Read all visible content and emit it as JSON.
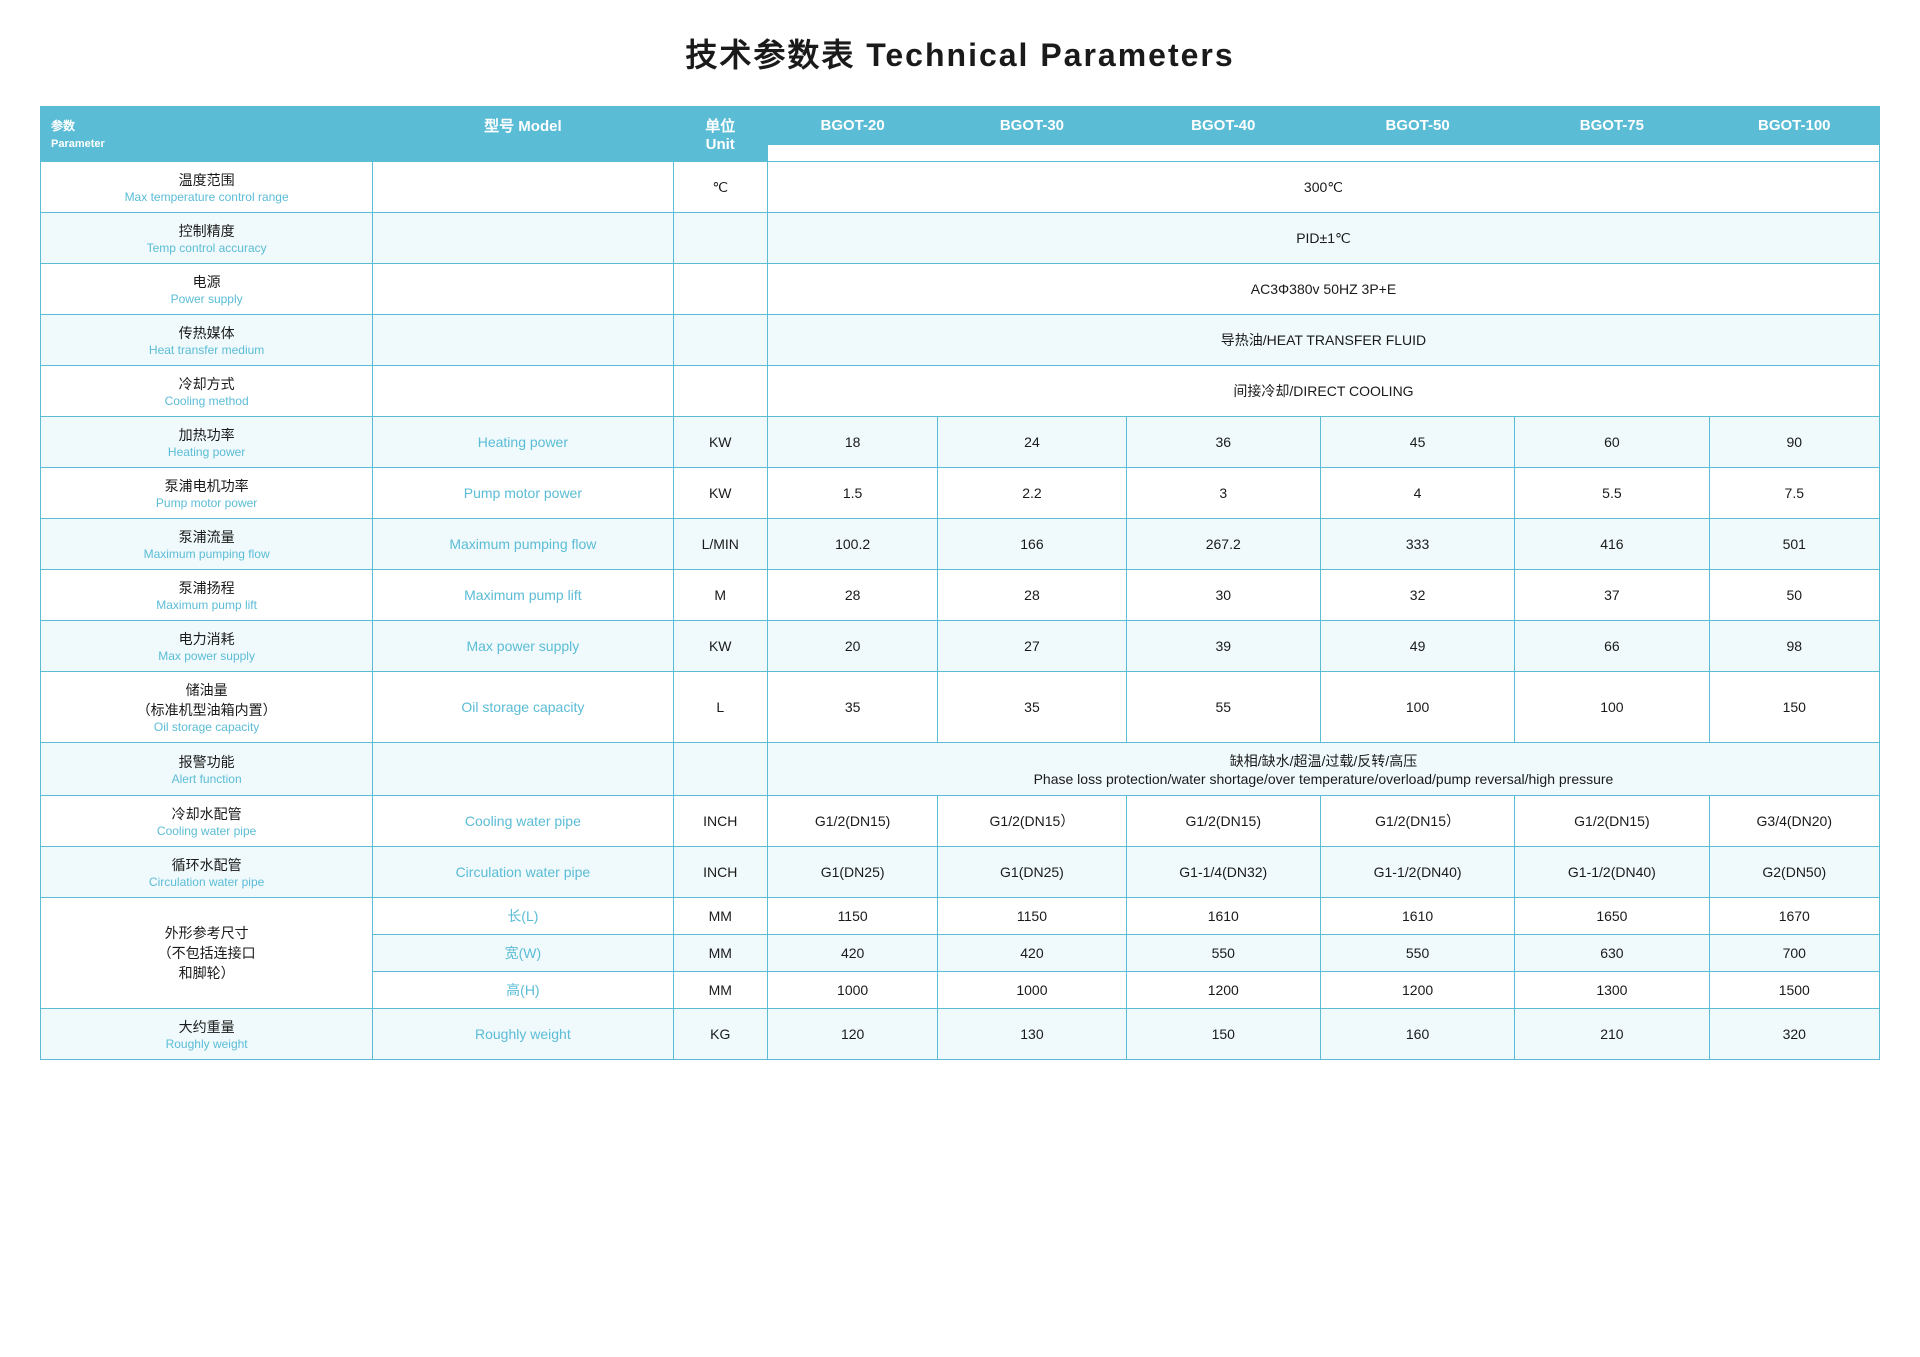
{
  "title": "技术参数表 Technical Parameters",
  "table": {
    "header": {
      "param_zh": "参数",
      "param_en": "Parameter",
      "model_zh": "型号",
      "model_en": "Model",
      "unit_zh": "单位",
      "unit_en": "Unit",
      "models": [
        "BGOT-20",
        "BGOT-30",
        "BGOT-40",
        "BGOT-50",
        "BGOT-75",
        "BGOT-100"
      ]
    },
    "rows": [
      {
        "param_zh": "温度范围",
        "param_en": "Max temperature control range",
        "unit": "℃",
        "span": true,
        "span_value": "300℃"
      },
      {
        "param_zh": "控制精度",
        "param_en": "Temp control accuracy",
        "unit": "",
        "span": true,
        "span_value": "PID±1℃"
      },
      {
        "param_zh": "电源",
        "param_en": "Power supply",
        "unit": "",
        "span": true,
        "span_value": "AC3Φ380v 50HZ 3P+E"
      },
      {
        "param_zh": "传热媒体",
        "param_en": "Heat transfer medium",
        "unit": "",
        "span": true,
        "span_value": "导热油/HEAT TRANSFER FLUID"
      },
      {
        "param_zh": "冷却方式",
        "param_en": "Cooling method",
        "unit": "",
        "span": true,
        "span_value": "间接冷却/DIRECT COOLING"
      },
      {
        "param_zh": "加热功率",
        "param_en": "Heating power",
        "unit": "KW",
        "span": false,
        "values": [
          "18",
          "24",
          "36",
          "45",
          "60",
          "90"
        ]
      },
      {
        "param_zh": "泵浦电机功率",
        "param_en": "Pump motor power",
        "unit": "KW",
        "span": false,
        "values": [
          "1.5",
          "2.2",
          "3",
          "4",
          "5.5",
          "7.5"
        ]
      },
      {
        "param_zh": "泵浦流量",
        "param_en": "Maximum pumping flow",
        "unit": "L/MIN",
        "span": false,
        "values": [
          "100.2",
          "166",
          "267.2",
          "333",
          "416",
          "501"
        ]
      },
      {
        "param_zh": "泵浦扬程",
        "param_en": "Maximum pump lift",
        "unit": "M",
        "span": false,
        "values": [
          "28",
          "28",
          "30",
          "32",
          "37",
          "50"
        ]
      },
      {
        "param_zh": "电力消耗",
        "param_en": "Max power supply",
        "unit": "KW",
        "span": false,
        "values": [
          "20",
          "27",
          "39",
          "49",
          "66",
          "98"
        ]
      },
      {
        "param_zh": "储油量\n（标准机型油箱内置）",
        "param_en": "Oil storage capacity",
        "unit": "L",
        "span": false,
        "values": [
          "35",
          "35",
          "55",
          "100",
          "100",
          "150"
        ]
      },
      {
        "param_zh": "报警功能",
        "param_en": "Alert function",
        "unit": "",
        "span": true,
        "span_value": "缺相/缺水/超温/过载/反转/高压\nPhase loss protection/water shortage/over temperature/overload/pump reversal/high pressure"
      },
      {
        "param_zh": "冷却水配管",
        "param_en": "Cooling water pipe",
        "unit": "INCH",
        "span": false,
        "values": [
          "G1/2(DN15)",
          "G1/2(DN15）",
          "G1/2(DN15)",
          "G1/2(DN15）",
          "G1/2(DN15)",
          "G3/4(DN20)"
        ]
      },
      {
        "param_zh": "循环水配管",
        "param_en": "Circulation water pipe",
        "unit": "INCH",
        "span": false,
        "values": [
          "G1(DN25)",
          "G1(DN25)",
          "G1-1/4(DN32)",
          "G1-1/2(DN40)",
          "G1-1/2(DN40)",
          "G2(DN50)"
        ]
      },
      {
        "param_zh": "外形参考尺寸\n（不包括连接口\n和脚轮）",
        "param_en": "长(L)",
        "unit": "MM",
        "span": false,
        "values": [
          "1150",
          "1150",
          "1610",
          "1610",
          "1650",
          "1670"
        ],
        "rowspan_label": true
      },
      {
        "param_zh": "",
        "param_en": "宽(W)",
        "unit": "MM",
        "span": false,
        "values": [
          "420",
          "420",
          "550",
          "550",
          "630",
          "700"
        ],
        "is_sub": true
      },
      {
        "param_zh": "",
        "param_en": "高(H)",
        "unit": "MM",
        "span": false,
        "values": [
          "1000",
          "1000",
          "1200",
          "1200",
          "1300",
          "1500"
        ],
        "is_sub": true
      },
      {
        "param_zh": "大约重量",
        "param_en": "Roughly weight",
        "unit": "KG",
        "span": false,
        "values": [
          "120",
          "130",
          "150",
          "160",
          "210",
          "320"
        ]
      }
    ]
  }
}
